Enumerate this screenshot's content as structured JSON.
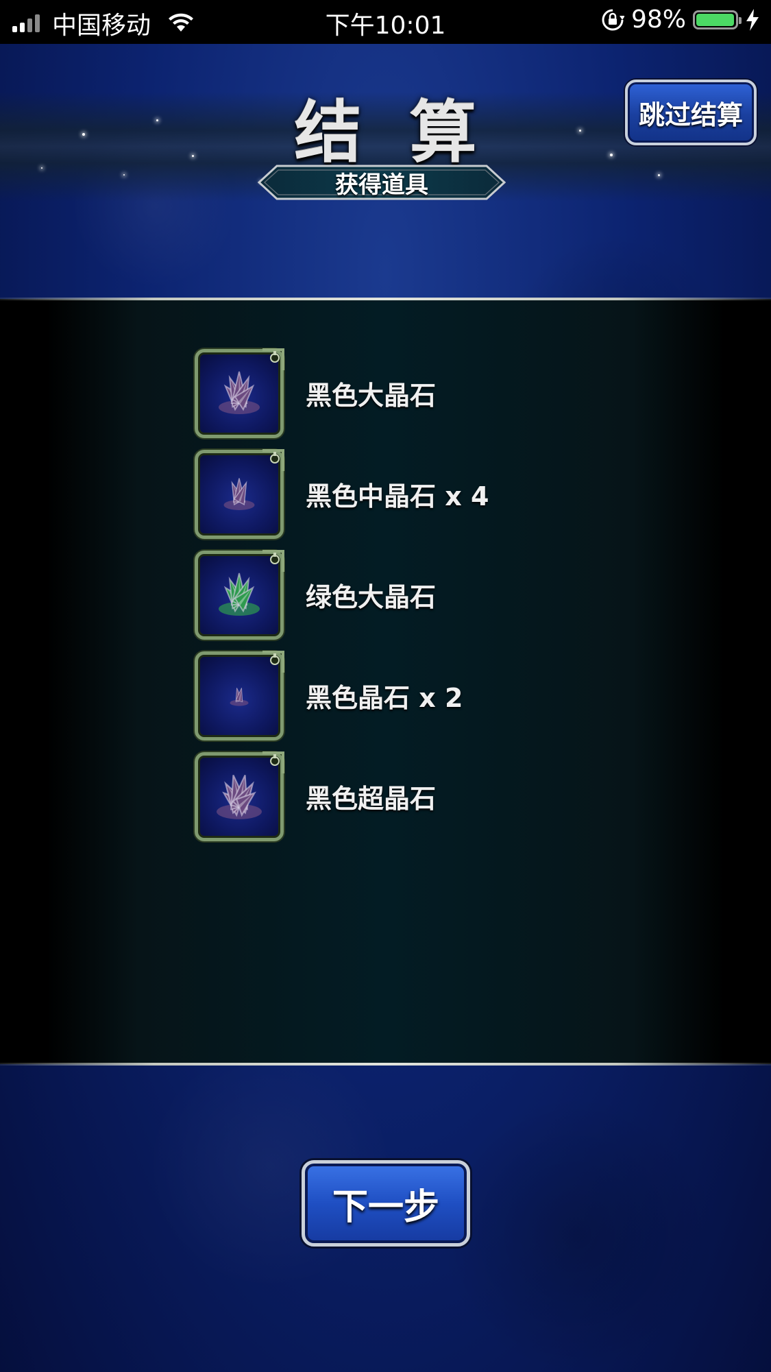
{
  "status_bar": {
    "carrier": "中国移动",
    "time": "下午10:01",
    "battery_percent": "98%",
    "battery_level": 0.98
  },
  "header": {
    "title": "结算",
    "subtitle": "获得道具",
    "skip_label": "跳过结算"
  },
  "items": [
    {
      "name": "黑色大晶石",
      "icon": "large-black-crystal-icon",
      "color": "#6b4a80"
    },
    {
      "name": "黑色中晶石 x 4",
      "icon": "medium-black-crystal-icon",
      "color": "#6b4a80"
    },
    {
      "name": "绿色大晶石",
      "icon": "large-green-crystal-icon",
      "color": "#2e9a4e"
    },
    {
      "name": "黑色晶石 x 2",
      "icon": "small-black-crystal-icon",
      "color": "#6b4a80"
    },
    {
      "name": "黑色超晶石",
      "icon": "super-black-crystal-icon",
      "color": "#6b4a80"
    }
  ],
  "footer": {
    "next_label": "下一步"
  }
}
